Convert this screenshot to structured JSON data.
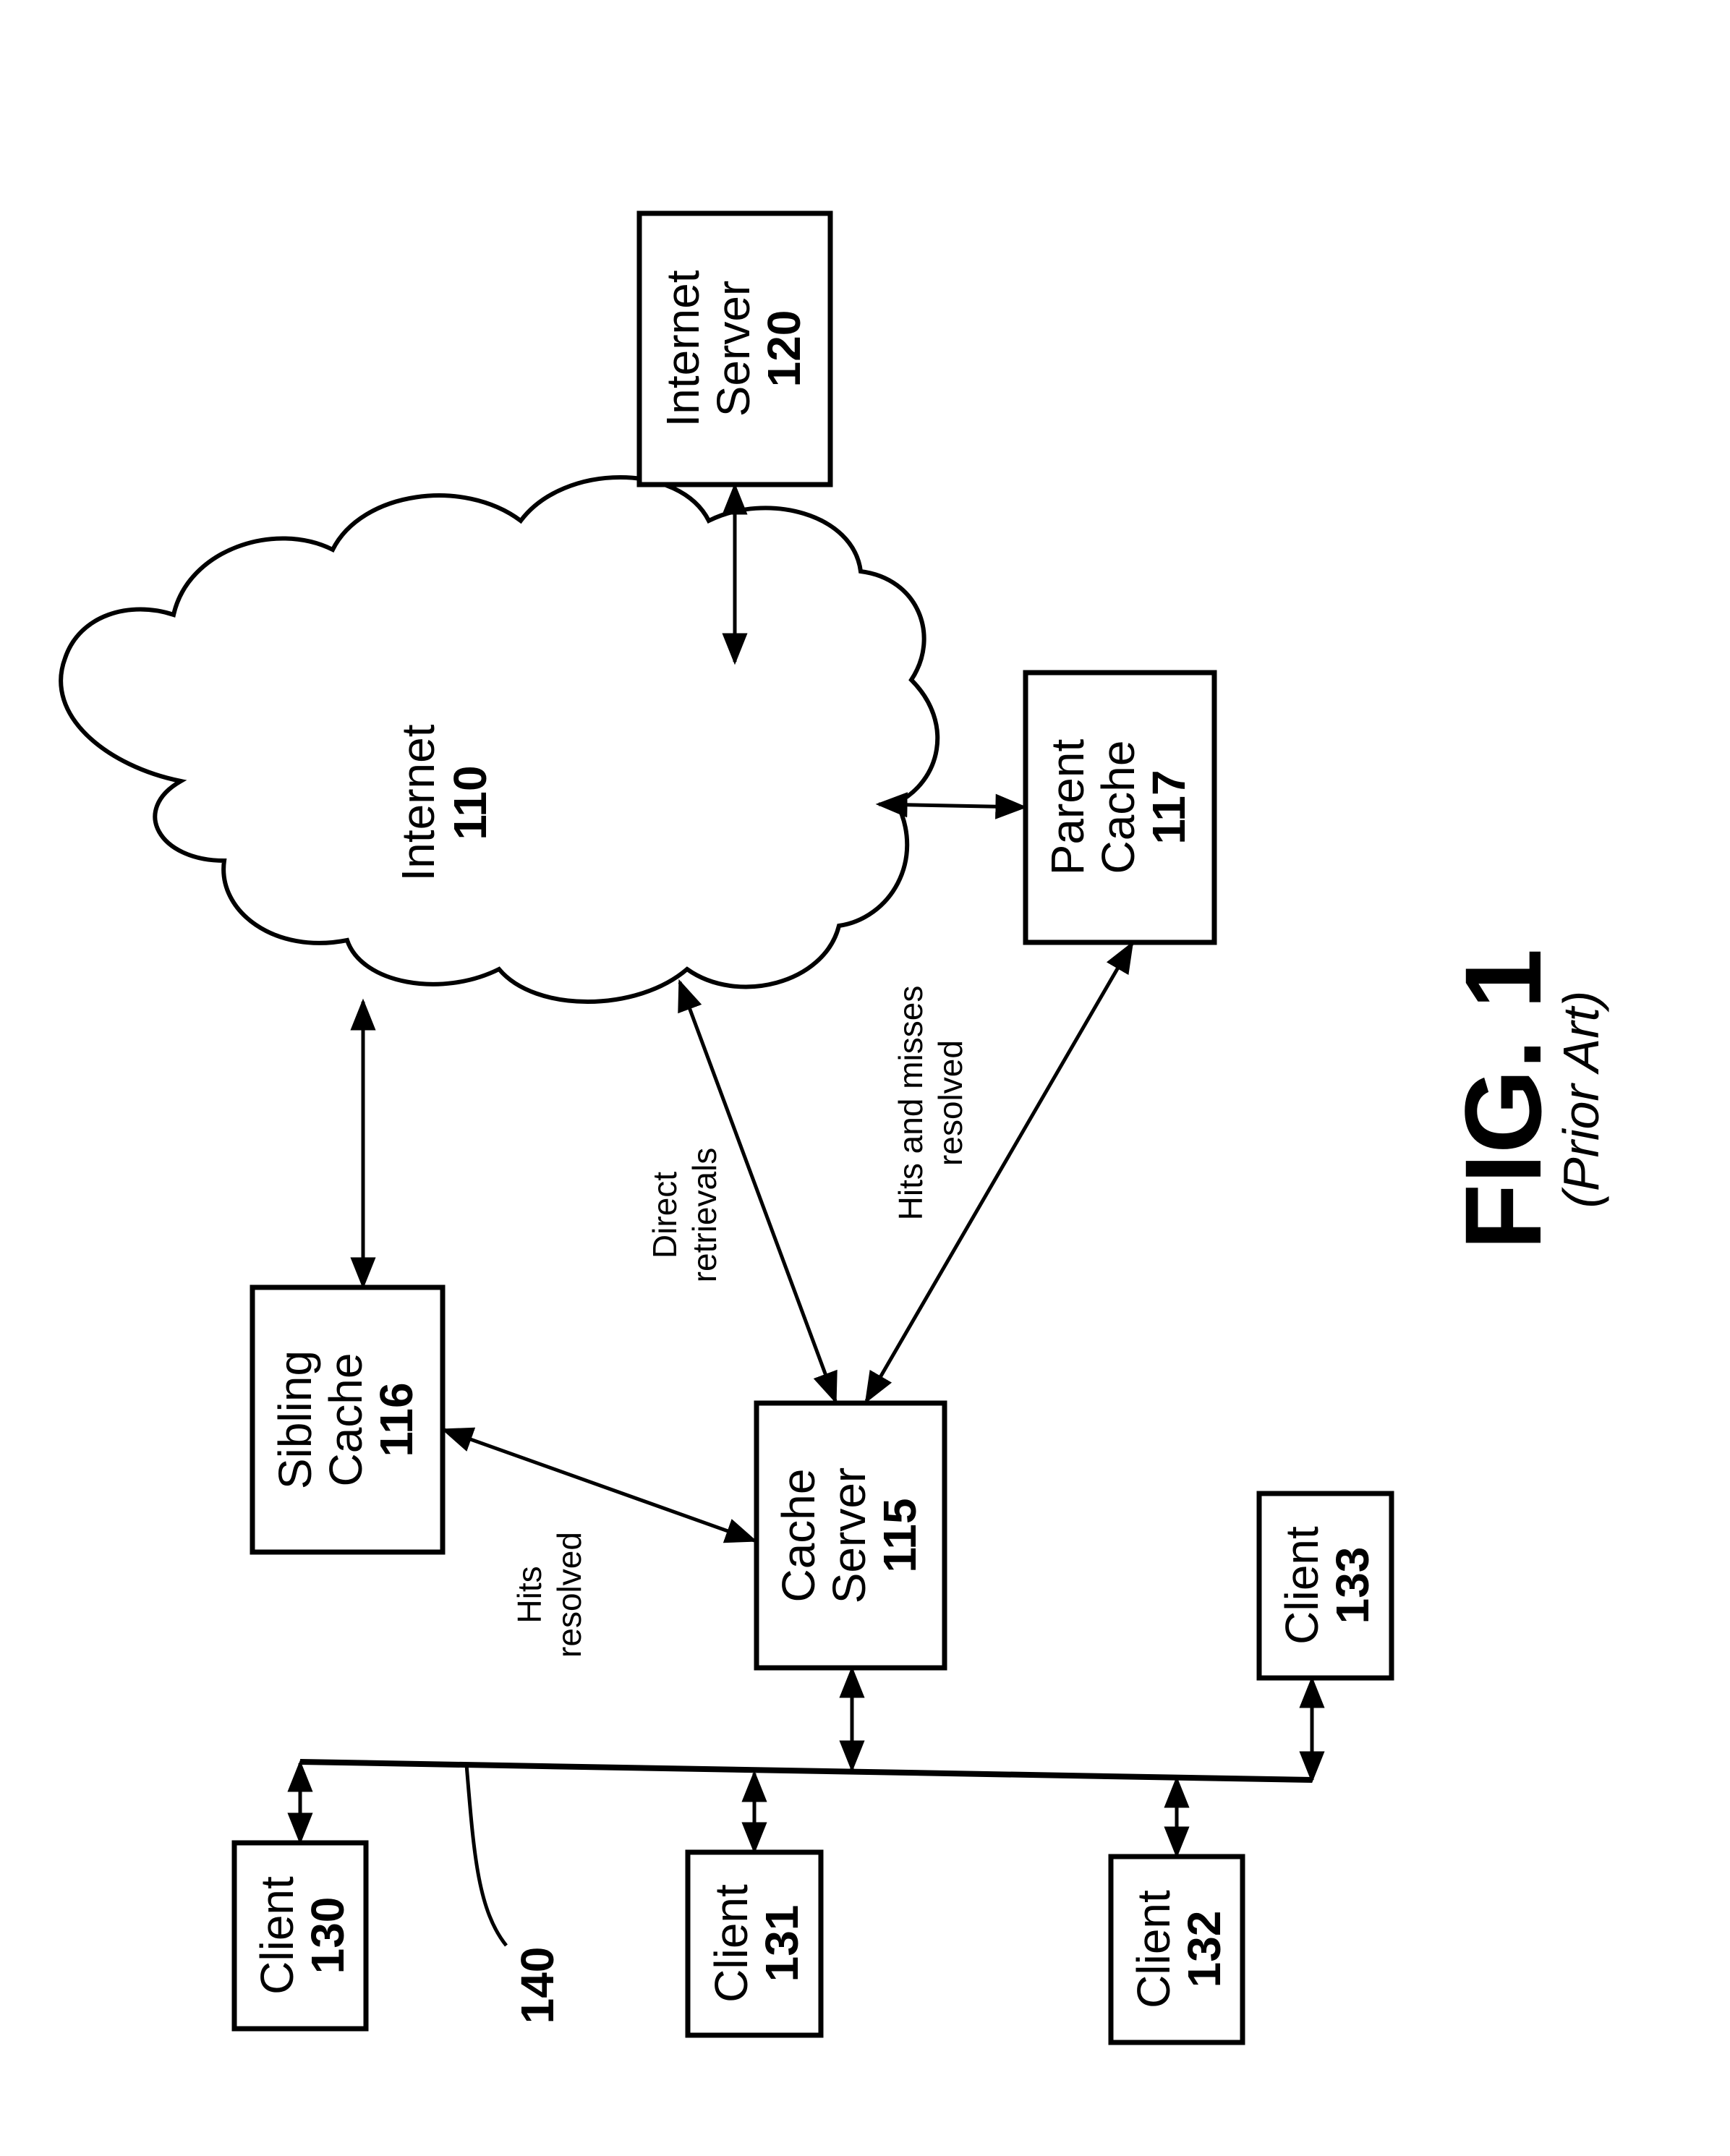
{
  "figure": {
    "title": "FIG. 1",
    "subtitle": "(Prior Art)",
    "orientation": "rotated 90 degrees counter-clockwise"
  },
  "nodes": {
    "internet": {
      "line1": "Internet",
      "line2": "110"
    },
    "internet_server": {
      "line1": "Internet",
      "line2": "Server",
      "line3": "120"
    },
    "parent_cache": {
      "line1": "Parent",
      "line2": "Cache",
      "line3": "117"
    },
    "sibling_cache": {
      "line1": "Sibling",
      "line2": "Cache",
      "line3": "116"
    },
    "cache_server": {
      "line1": "Cache",
      "line2": "Server",
      "line3": "115"
    },
    "client_130": {
      "line1": "Client",
      "line2": "130"
    },
    "client_131": {
      "line1": "Client",
      "line2": "131"
    },
    "client_132": {
      "line1": "Client",
      "line2": "132"
    },
    "client_133": {
      "line1": "Client",
      "line2": "133"
    }
  },
  "edge_labels": {
    "direct": {
      "line1": "Direct",
      "line2": "retrievals"
    },
    "parent": {
      "line1": "Hits and misses",
      "line2": "resolved"
    },
    "sibling": {
      "line1": "Hits",
      "line2": "resolved"
    }
  },
  "network": {
    "label": "140"
  },
  "connections": [
    {
      "from": "Internet Server 120",
      "to": "Internet 110",
      "type": "bidirectional"
    },
    {
      "from": "Internet 110",
      "to": "Parent Cache 117",
      "type": "bidirectional"
    },
    {
      "from": "Internet 110",
      "to": "Sibling Cache 116",
      "type": "bidirectional"
    },
    {
      "from": "Internet 110",
      "to": "Cache Server 115",
      "type": "bidirectional",
      "label": "Direct retrievals"
    },
    {
      "from": "Parent Cache 117",
      "to": "Cache Server 115",
      "type": "bidirectional",
      "label": "Hits and misses resolved"
    },
    {
      "from": "Sibling Cache 116",
      "to": "Cache Server 115",
      "type": "bidirectional",
      "label": "Hits resolved"
    },
    {
      "from": "Cache Server 115",
      "to": "Network 140",
      "type": "bidirectional"
    },
    {
      "from": "Network 140",
      "to": "Client 130",
      "type": "bidirectional"
    },
    {
      "from": "Network 140",
      "to": "Client 131",
      "type": "bidirectional"
    },
    {
      "from": "Network 140",
      "to": "Client 132",
      "type": "bidirectional"
    },
    {
      "from": "Network 140",
      "to": "Client 133",
      "type": "bidirectional"
    }
  ]
}
